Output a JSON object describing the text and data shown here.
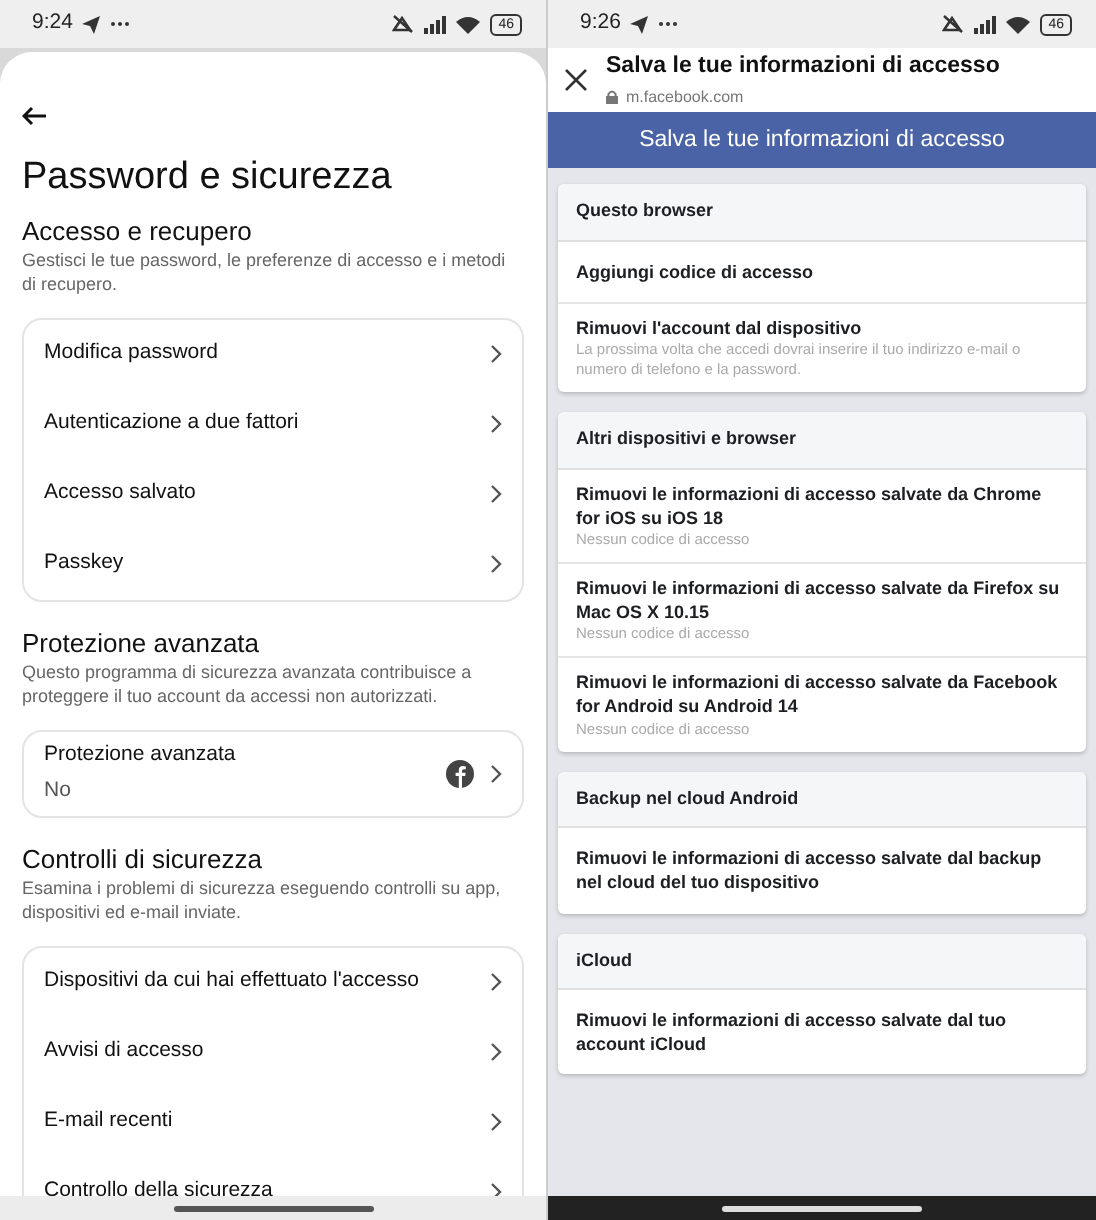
{
  "left": {
    "status_bar": {
      "time": "9:24",
      "battery": "46"
    },
    "title": "Password e sicurezza",
    "sections": [
      {
        "heading": "Accesso e recupero",
        "description": "Gestisci le tue password, le preferenze di accesso e i metodi di recupero.",
        "items": [
          {
            "label": "Modifica password"
          },
          {
            "label": "Autenticazione a due fattori"
          },
          {
            "label": "Accesso salvato"
          },
          {
            "label": "Passkey"
          }
        ]
      },
      {
        "heading": "Protezione avanzata",
        "description": "Questo programma di sicurezza avanzata contribuisce a proteggere il tuo account da accessi non autorizzati.",
        "items": [
          {
            "label": "Protezione avanzata",
            "value": "No",
            "kind": "logo"
          }
        ]
      },
      {
        "heading": "Controlli di sicurezza",
        "description": "Esamina i problemi di sicurezza eseguendo controlli su app, dispositivi ed e-mail inviate.",
        "items": [
          {
            "label": "Dispositivi da cui hai effettuato l'accesso"
          },
          {
            "label": "Avvisi di accesso"
          },
          {
            "label": "E-mail recenti"
          },
          {
            "label": "Controllo della sicurezza"
          }
        ]
      }
    ]
  },
  "right": {
    "status_bar": {
      "time": "9:26",
      "battery": "46"
    },
    "header": {
      "title": "Salva le tue informazioni di accesso",
      "url": "m.facebook.com"
    },
    "banner": "Salva le tue informazioni di accesso",
    "cards": [
      {
        "heading": "Questo browser",
        "items": [
          {
            "label": "Aggiungi codice di accesso"
          },
          {
            "label": "Rimuovi l'account dal dispositivo",
            "note": "La prossima volta che accedi dovrai inserire il tuo indirizzo e-mail o numero di telefono e la password."
          }
        ]
      },
      {
        "heading": "Altri dispositivi e browser",
        "items": [
          {
            "label": "Rimuovi le informazioni di accesso salvate da Chrome for iOS su iOS 18",
            "note": "Nessun codice di accesso"
          },
          {
            "label": "Rimuovi le informazioni di accesso salvate da Firefox su Mac OS X 10.15",
            "note": "Nessun codice di accesso"
          },
          {
            "label": "Rimuovi le informazioni di accesso salvate da Facebook for Android su Android 14",
            "note": "Nessun codice di accesso"
          }
        ]
      },
      {
        "heading": "Backup nel cloud Android",
        "items": [
          {
            "label": "Rimuovi le informazioni di accesso salvate dal backup nel cloud del tuo dispositivo"
          }
        ]
      },
      {
        "heading": "iCloud",
        "items": [
          {
            "label": "Rimuovi le informazioni di accesso salvate dal tuo account iCloud"
          }
        ]
      }
    ]
  }
}
